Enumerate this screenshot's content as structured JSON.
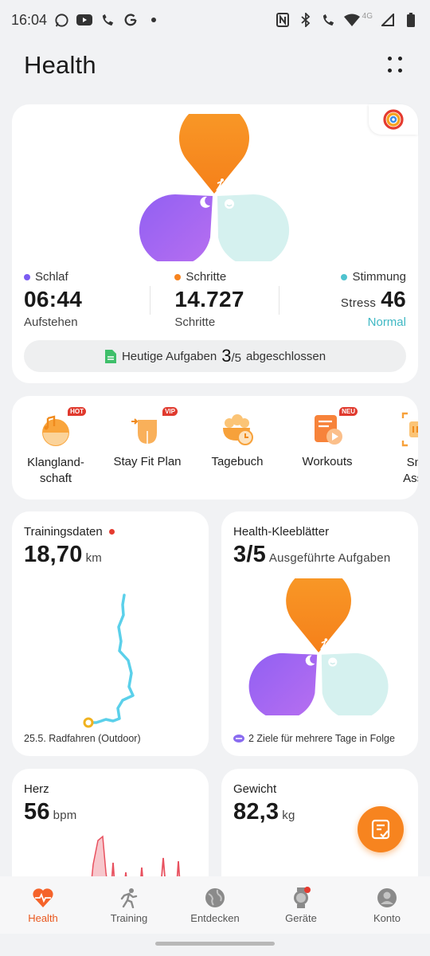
{
  "status_bar": {
    "time": "16:04",
    "network_label": "4G",
    "left_icons": [
      "whatsapp-icon",
      "youtube-icon",
      "wifi-call-icon",
      "google-icon",
      "dot-icon"
    ],
    "right_icons": [
      "nfc-icon",
      "bluetooth-icon",
      "wifi-call-icon",
      "wifi-icon",
      "signal-icon",
      "battery-icon"
    ]
  },
  "header": {
    "title": "Health"
  },
  "summary": {
    "sleep": {
      "label": "Schlaf",
      "value": "06:44",
      "sub": "Aufstehen",
      "color": "#7b5cf2"
    },
    "steps": {
      "label": "Schritte",
      "value": "14.727",
      "sub": "Schritte",
      "color": "#f7841f"
    },
    "mood": {
      "label": "Stimmung",
      "prefix": "Stress",
      "value": "46",
      "sub": "Normal",
      "color": "#4fc3cf"
    },
    "tasks": {
      "label": "Heutige Aufgaben",
      "done": "3",
      "total": "/5",
      "suffix": "abgeschlossen"
    }
  },
  "services": [
    {
      "label": "Klangland-\nschaft",
      "tag": "HOT"
    },
    {
      "label": "Stay Fit Plan",
      "tag": "VIP"
    },
    {
      "label": "Tagebuch",
      "tag": ""
    },
    {
      "label": "Workouts",
      "tag": "NEU"
    },
    {
      "label": "Sna\nAssis",
      "tag": ""
    }
  ],
  "training": {
    "title": "Trainingsdaten",
    "value": "18,70",
    "unit": "km",
    "footer": "25.5. Radfahren (Outdoor)"
  },
  "clover": {
    "title": "Health-Kleeblätter",
    "value": "3/5",
    "unit": "Ausgeführte Aufgaben",
    "footer": "2 Ziele für mehrere Tage in Folge"
  },
  "heart": {
    "title": "Herz",
    "value": "56",
    "unit": "bpm"
  },
  "weight": {
    "title": "Gewicht",
    "value": "82,3",
    "unit": "kg"
  },
  "nav": [
    {
      "label": "Health",
      "icon": "heart-icon",
      "active": true
    },
    {
      "label": "Training",
      "icon": "runner-icon",
      "active": false
    },
    {
      "label": "Entdecken",
      "icon": "globe-icon",
      "active": false
    },
    {
      "label": "Geräte",
      "icon": "watch-icon",
      "active": false
    },
    {
      "label": "Konto",
      "icon": "account-icon",
      "active": false
    }
  ],
  "colors": {
    "accent": "#f7841f",
    "active_nav": "#e9581e",
    "route": "#5bd0ea"
  }
}
